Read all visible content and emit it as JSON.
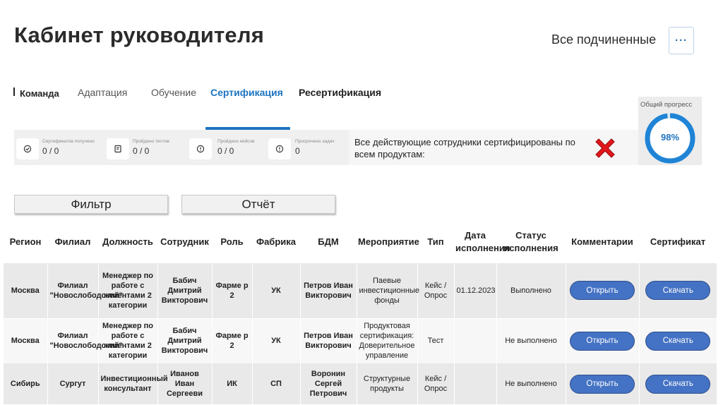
{
  "header": {
    "title": "Кабинет руководителя",
    "scope_label": "Все подчиненные",
    "more_label": "···"
  },
  "tabs": [
    {
      "label": "Команда"
    },
    {
      "label": "Адаптация"
    },
    {
      "label": "Обучение"
    },
    {
      "label": "Сертификация"
    },
    {
      "label": "Ресертификация"
    }
  ],
  "active_tab": "Сертификация",
  "stats": [
    {
      "label": "Сертификатов получено",
      "value": "0 / 0",
      "icon": "badge-check-icon"
    },
    {
      "label": "Пройдено тестов",
      "value": "0 / 0",
      "icon": "test-doc-icon"
    },
    {
      "label": "Пройдено кейсов",
      "value": "0 / 0",
      "icon": "info-circle-icon"
    },
    {
      "label": "Просрочено задач",
      "value": "0",
      "icon": "info-circle-icon"
    }
  ],
  "certification_message": "Все действующие сотрудники сертифицированы по всем продуктам:",
  "progress": {
    "title": "Общий прогресс",
    "label": "98%",
    "fraction": 0.98
  },
  "buttons": {
    "filter": "Фильтр",
    "report": "Отчёт"
  },
  "table": {
    "columns": [
      "Регион",
      "Филиал",
      "Должность",
      "Сотрудник",
      "Роль",
      "Фабрика",
      "БДМ",
      "Мероприятие",
      "Тип",
      "Дата исполнения",
      "Статус исполнения",
      "Комментарии",
      "Сертификат"
    ],
    "rows": [
      {
        "region": "Москва",
        "branch": "Филиал \"Новослободский\"",
        "position": "Менеджер по работе с клиентами 2 категории",
        "employee": "Бабич Дмитрий Викторович",
        "role": "Фарме р 2",
        "factory": "УК",
        "bdm": "Петров Иван Викторович",
        "event": "Паевые инвестиционные фонды",
        "type": "Кейс / Опрос",
        "date": "01.12.2023",
        "status": "Выполнено",
        "comment_btn": "Открыть",
        "cert_btn": "Скачать"
      },
      {
        "region": "Москва",
        "branch": "Филиал \"Новослободский\"",
        "position": "Менеджер по работе с клиентами 2 категории",
        "employee": "Бабич Дмитрий Викторович",
        "role": "Фарме р 2",
        "factory": "УК",
        "bdm": "Петров Иван Викторович",
        "event": "Продуктовая сертификация: Доверительное управление",
        "type": "Тест",
        "date": "",
        "status": "Не выполнено",
        "comment_btn": "Открыть",
        "cert_btn": "Скачать"
      },
      {
        "region": "Сибирь",
        "branch": "Сургут",
        "position": "Инвестиционный консультант",
        "employee": "Иванов Иван Сергееви",
        "role": "ИК",
        "factory": "СП",
        "bdm": "Воронин Сергей Петрович",
        "event": "Структурные продукты",
        "type": "Кейс / Опрос",
        "date": "",
        "status": "Не выполнено",
        "comment_btn": "Открыть",
        "cert_btn": "Скачать"
      }
    ]
  },
  "colors": {
    "accent": "#1d74c0",
    "button": "#4472c4",
    "success": "#1a9a2f",
    "error": "#e3161b",
    "cross": "#e3161b"
  }
}
